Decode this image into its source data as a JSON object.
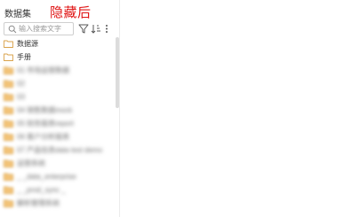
{
  "sidebar": {
    "title": "数据集",
    "annotation": "隐藏后",
    "search": {
      "placeholder": "输入搜索文字",
      "value": ""
    },
    "toolbar_icons": [
      "filter-icon",
      "sort-icon",
      "more-icon"
    ],
    "folders": [
      {
        "label": "数据源",
        "icon": "folder-outline-icon",
        "blurred": false
      },
      {
        "label": "手册",
        "icon": "folder-outline-icon",
        "blurred": false
      },
      {
        "label": "01 市场运营数据",
        "icon": "folder-icon",
        "blurred": true
      },
      {
        "label": "02",
        "icon": "folder-icon",
        "blurred": true
      },
      {
        "label": "03",
        "icon": "folder-icon",
        "blurred": true
      },
      {
        "label": "04 销售数据mock",
        "icon": "folder-icon",
        "blurred": true
      },
      {
        "label": "05 财务报表report",
        "icon": "folder-icon",
        "blurred": true
      },
      {
        "label": "06 客户分析报表",
        "icon": "folder-icon",
        "blurred": true
      },
      {
        "label": "07 产品信息data test demo",
        "icon": "folder-icon",
        "blurred": true
      },
      {
        "label": "运营系统",
        "icon": "folder-icon",
        "blurred": true
      },
      {
        "label": "_ _data_enterprise",
        "icon": "folder-icon",
        "blurred": true
      },
      {
        "label": "_ _prod_sync _",
        "icon": "folder-icon",
        "blurred": true
      },
      {
        "label": "解析管理系统",
        "icon": "folder-icon",
        "blurred": true
      }
    ]
  },
  "colors": {
    "folder_outline": "#d9a24a",
    "folder_fill": "#f4c57a",
    "annotation": "#e01515",
    "icon": "#555555"
  }
}
